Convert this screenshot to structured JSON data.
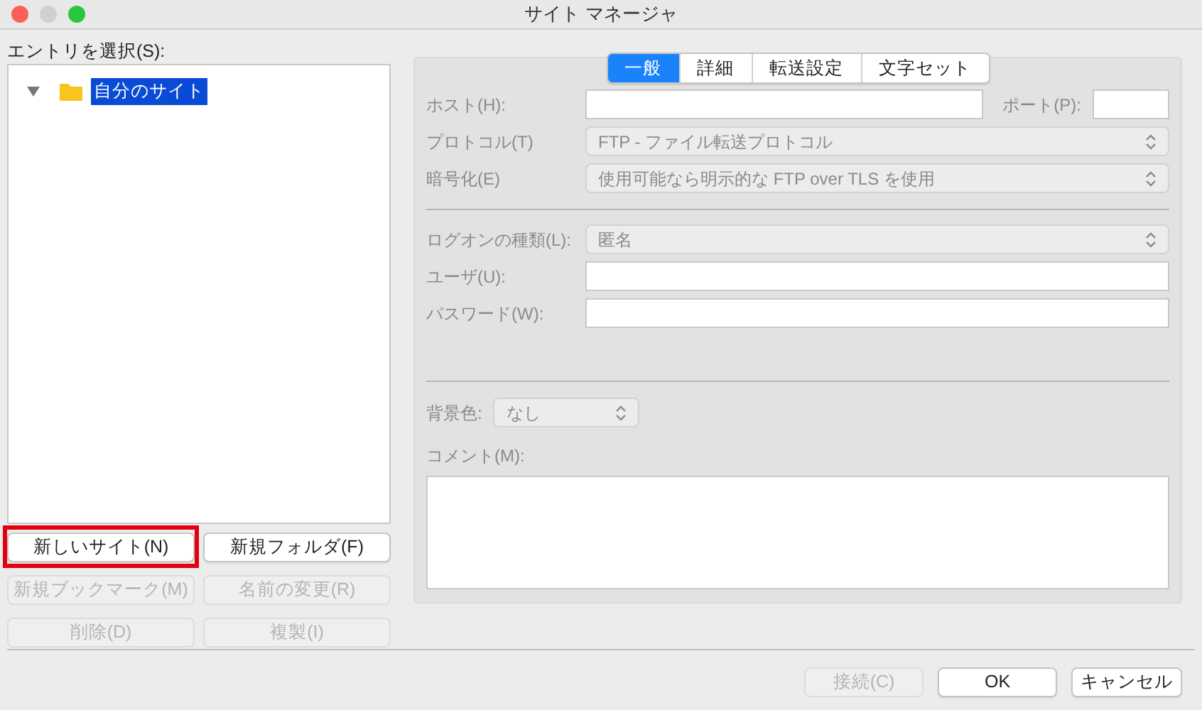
{
  "window": {
    "title": "サイト マネージャ"
  },
  "entry_label": "エントリを選択(S):",
  "tree": [
    {
      "label": "自分のサイト",
      "expanded": true,
      "selected": true
    }
  ],
  "left_buttons": [
    {
      "label": "新しいサイト(N)",
      "disabled": false,
      "highlighted": true
    },
    {
      "label": "新規フォルダ(F)",
      "disabled": false,
      "highlighted": false
    },
    {
      "label": "新規ブックマーク(M)",
      "disabled": true,
      "highlighted": false
    },
    {
      "label": "名前の変更(R)",
      "disabled": true,
      "highlighted": false
    },
    {
      "label": "削除(D)",
      "disabled": true,
      "highlighted": false
    },
    {
      "label": "複製(I)",
      "disabled": true,
      "highlighted": false
    }
  ],
  "tabs": [
    {
      "label": "一般",
      "selected": true
    },
    {
      "label": "詳細",
      "selected": false
    },
    {
      "label": "転送設定",
      "selected": false
    },
    {
      "label": "文字セット",
      "selected": false
    }
  ],
  "form": {
    "host_label": "ホスト(H):",
    "port_label": "ポート(P):",
    "protocol_label": "プロトコル(T)",
    "protocol_value": "FTP - ファイル転送プロトコル",
    "encryption_label": "暗号化(E)",
    "encryption_value": "使用可能なら明示的な FTP over TLS を使用",
    "logon_label": "ログオンの種類(L):",
    "logon_value": "匿名",
    "user_label": "ユーザ(U):",
    "password_label": "パスワード(W):",
    "bgcolor_label": "背景色:",
    "bgcolor_value": "なし",
    "comment_label": "コメント(M):"
  },
  "bottom_buttons": [
    {
      "label": "接続(C)",
      "disabled": true
    },
    {
      "label": "OK",
      "disabled": false
    },
    {
      "label": "キャンセル",
      "disabled": false
    }
  ]
}
